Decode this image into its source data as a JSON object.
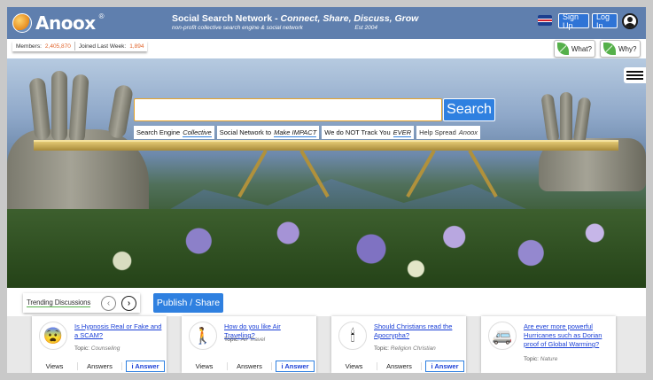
{
  "header": {
    "logo_text": "Anoox",
    "logo_reg": "®",
    "title_prefix": "Social Search Network - ",
    "title_emph": "Connect, Share, Discuss, Grow",
    "subtitle": "non-profit collective search engine & social network",
    "est": "Est 2004",
    "signup_label": "Sign Up",
    "login_label": "Log In"
  },
  "stats": {
    "members_label": "Members:",
    "members_value": "2,405,870",
    "joined_label": "Joined Last Week:",
    "joined_value": "1,894"
  },
  "info_buttons": {
    "what": "What?",
    "why": "Why?"
  },
  "search": {
    "placeholder": "",
    "button_label": "Search"
  },
  "chips": [
    {
      "prefix": "Search Engine",
      "emph": "Collective"
    },
    {
      "prefix": "Social Network to",
      "emph": "Make IMPACT"
    },
    {
      "prefix": "We do NOT Track You",
      "emph": "EVER"
    },
    {
      "prefix": "Help Spread",
      "emph": "Anoox"
    }
  ],
  "trending": {
    "label": "Trending Discussions",
    "prev": "‹",
    "next": "›",
    "publish_label": "Publish / Share"
  },
  "cards": [
    {
      "avatar": "😨",
      "question": "Is Hypnosis Real or Fake and a SCAM?",
      "topic_label": "Topic:",
      "topic": "Counseling",
      "views": "Views",
      "answers": "Answers",
      "answer_btn": "i Answer"
    },
    {
      "avatar": "🚶",
      "question": "How do you like Air Traveling?",
      "topic_label": "Topic:",
      "topic": "Air Travel",
      "views": "Views",
      "answers": "Answers",
      "answer_btn": "i Answer"
    },
    {
      "avatar": "🕯",
      "question": "Should Christians read the Apocrypha?",
      "topic_label": "Topic:",
      "topic": "Religion Christian",
      "views": "Views",
      "answers": "Answers",
      "answer_btn": "i Answer"
    },
    {
      "avatar": "🚐",
      "question": "Are ever more powerful Hurricanes such as Dorian proof of Global Warming?",
      "topic_label": "Topic:",
      "topic": "Nature",
      "views": "",
      "answers": "",
      "answer_btn": ""
    }
  ],
  "colors": {
    "header_bg": "#5f7fae",
    "accent_blue": "#2f80e0",
    "stat_orange": "#e0632a",
    "leaf_green": "#55b04a"
  }
}
